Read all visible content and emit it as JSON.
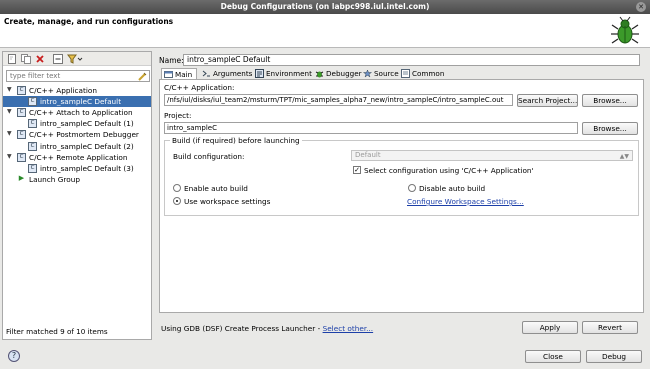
{
  "window": {
    "title": "Debug Configurations  (on labpc998.iul.intel.com)"
  },
  "header": {
    "title": "Create, manage, and run configurations",
    "icon": "bug-icon"
  },
  "left": {
    "filter_placeholder": "type filter text",
    "tree": [
      {
        "label": "C/C++ Application",
        "level": 0,
        "expanded": true,
        "icon": "c-app-icon",
        "selected": false
      },
      {
        "label": "intro_sampleC Default",
        "level": 1,
        "icon": "c-app-icon",
        "selected": true
      },
      {
        "label": "C/C++ Attach to Application",
        "level": 0,
        "expanded": true,
        "icon": "c-app-icon",
        "selected": false
      },
      {
        "label": "intro_sampleC Default (1)",
        "level": 1,
        "icon": "c-app-icon",
        "selected": false
      },
      {
        "label": "C/C++ Postmortem Debugger",
        "level": 0,
        "expanded": true,
        "icon": "c-app-icon",
        "selected": false
      },
      {
        "label": "intro_sampleC Default (2)",
        "level": 1,
        "icon": "c-app-icon",
        "selected": false
      },
      {
        "label": "C/C++ Remote Application",
        "level": 0,
        "expanded": true,
        "icon": "c-app-icon",
        "selected": false
      },
      {
        "label": "intro_sampleC Default (3)",
        "level": 1,
        "icon": "c-app-icon",
        "selected": false
      },
      {
        "label": "Launch Group",
        "level": 0,
        "expanded": false,
        "icon": "launch-group-icon",
        "selected": false
      }
    ],
    "status": "Filter matched 9 of 10 items"
  },
  "config": {
    "name_label": "Name:",
    "name_value": "intro_sampleC Default",
    "tabs": [
      {
        "label": "Main",
        "icon": "main-tab-icon",
        "active": true
      },
      {
        "label": "Arguments",
        "icon": "arguments-tab-icon",
        "active": false
      },
      {
        "label": "Environment",
        "icon": "environment-tab-icon",
        "active": false
      },
      {
        "label": "Debugger",
        "icon": "debugger-tab-icon",
        "active": false
      },
      {
        "label": "Source",
        "icon": "source-tab-icon",
        "active": false
      },
      {
        "label": "Common",
        "icon": "common-tab-icon",
        "active": false
      }
    ],
    "app_label": "C/C++ Application:",
    "app_value": "/nfs/iul/disks/iul_team2/msturm/TPT/mic_samples_alpha7_new/intro_sampleC/intro_sampleC.out",
    "search_project": "Search Project...",
    "browse": "Browse...",
    "project_label": "Project:",
    "project_value": "intro_sampleC",
    "build_group_title": "Build (if required) before launching",
    "build_config_label": "Build configuration:",
    "build_config_value": "Default",
    "select_config_label": "Select configuration using 'C/C++ Application'",
    "enable_auto_build": "Enable auto build",
    "disable_auto_build": "Disable auto build",
    "use_workspace": "Use workspace settings",
    "configure_workspace": "Configure Workspace Settings...",
    "launcher_text": "Using GDB (DSF) Create Process Launcher - ",
    "select_other": "Select other...",
    "apply": "Apply",
    "revert": "Revert"
  },
  "footer": {
    "close": "Close",
    "debug": "Debug",
    "help_icon": "help-icon"
  }
}
